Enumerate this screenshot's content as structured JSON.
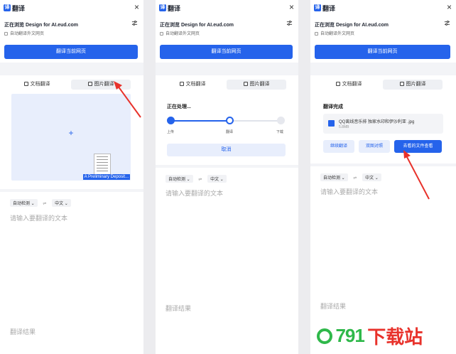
{
  "app": {
    "title": "翻译"
  },
  "site_line": "正在浏览 Design for AI.eud.com",
  "auto_translate_label": "自动翻译外文网页",
  "translate_page_button": "翻译当前网页",
  "tabs": {
    "doc": "文档翻译",
    "image": "图片翻译"
  },
  "dropzone": {
    "plus": "+",
    "thumb_label": "A Preliminary Deposit..."
  },
  "lang": {
    "source": "自动检测",
    "target": "中文",
    "swap": "⇌"
  },
  "input_placeholder": "请输入要翻译的文本",
  "result_label": "翻译结果",
  "processing": {
    "title": "正在处理...",
    "steps": [
      "上传",
      "翻译",
      "下载"
    ],
    "cancel": "取消"
  },
  "done": {
    "title": "翻译完成",
    "file_name": "QQ离线音乐排 独家水印和伊沙利亚 .jpg",
    "file_size": "5.8MB",
    "buttons": [
      "继续翻译",
      "双图对照",
      "去看的文件查看"
    ]
  },
  "watermark": {
    "number": "791",
    "text": "下载站"
  },
  "colors": {
    "accent": "#2563eb",
    "arrow": "#e8322b"
  }
}
